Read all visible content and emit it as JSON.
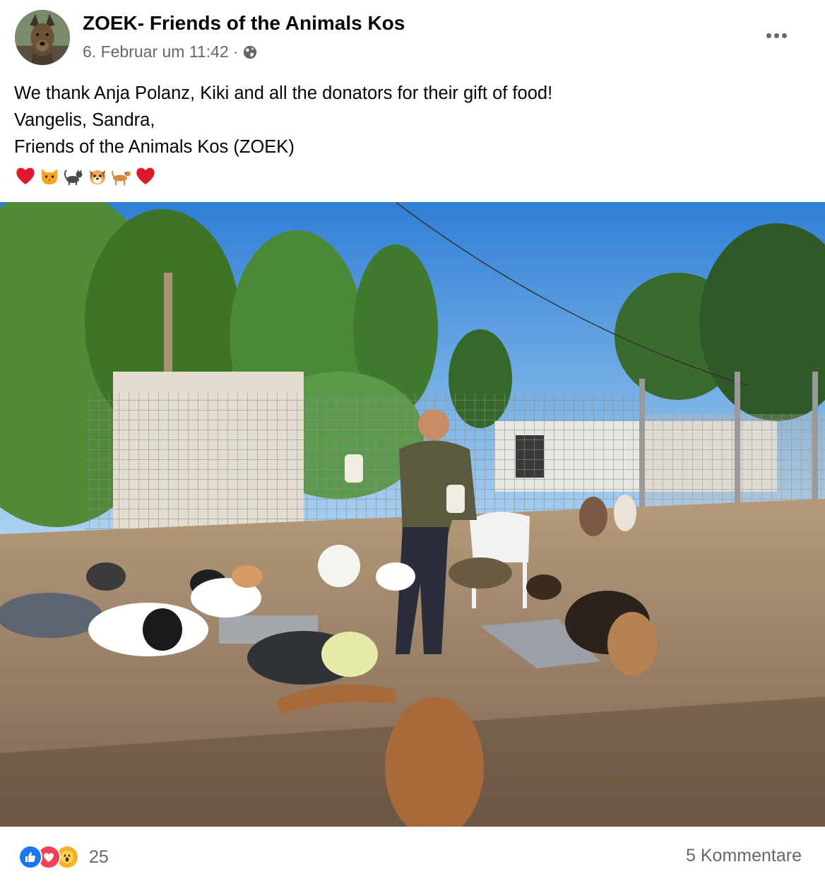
{
  "post": {
    "page_name": "ZOEK- Friends of the Animals Kos",
    "timestamp": "6. Februar um 11:42",
    "separator": "·",
    "privacy_icon": "globe-icon",
    "more_icon": "more-options-icon",
    "text_lines": [
      "We thank Anja Polanz, Kiki and all the donators for their gift of food!",
      "Vangelis, Sandra,",
      "Friends of the Animals Kos (ZOEK)"
    ],
    "emojis": [
      "red-heart",
      "cat-face",
      "cat",
      "dog-face",
      "dog",
      "red-heart"
    ]
  },
  "footer": {
    "reaction_icons": [
      "like-icon",
      "love-icon",
      "wow-icon"
    ],
    "reaction_count": "25",
    "comments_label": "5 Kommentare"
  },
  "colors": {
    "text_primary": "#050505",
    "text_secondary": "#65676b",
    "like_blue": "#1877f2",
    "love_red": "#f33e58",
    "wow_yellow": "#f7b125"
  }
}
